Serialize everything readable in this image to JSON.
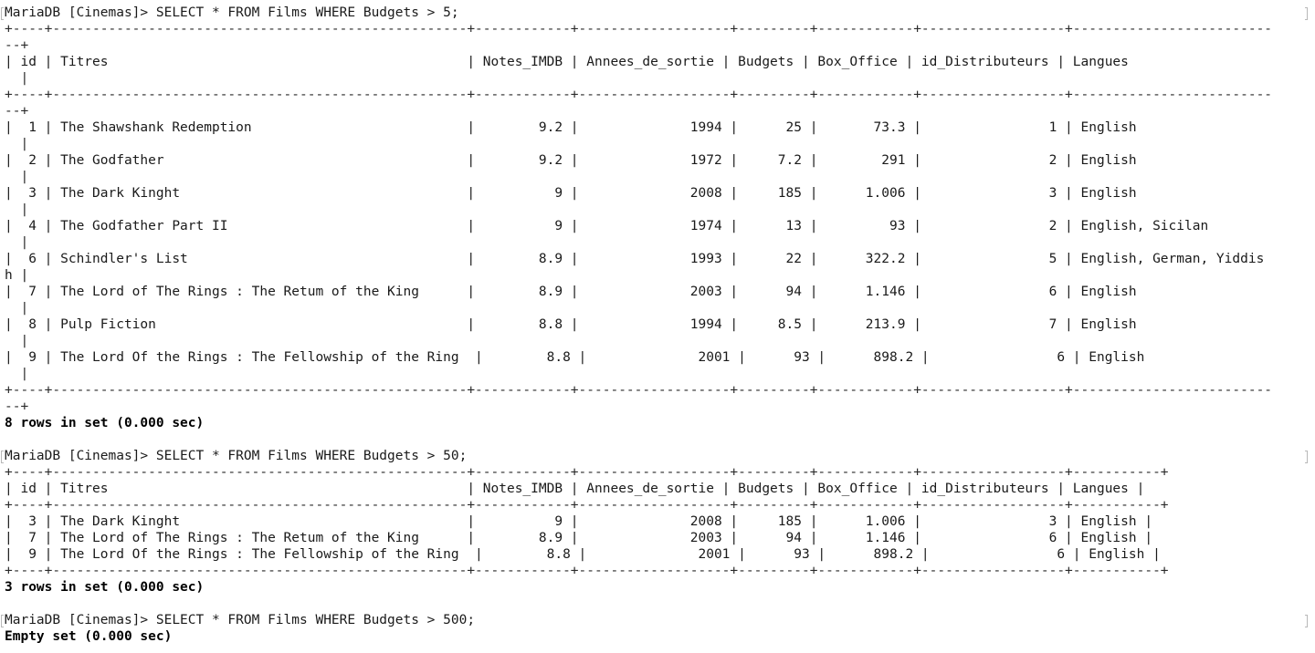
{
  "terminal": {
    "lines": [
      {
        "text": "MariaDB [Cinemas]> SELECT * FROM Films WHERE Budgets > 5;",
        "kind": "prompt"
      },
      {
        "text": "+----+----------------------------------------------------+------------+-------------------+---------+------------+------------------+-------------------------",
        "kind": "border"
      },
      {
        "text": "--+",
        "kind": "border"
      },
      {
        "text": "| id | Titres                                             | Notes_IMDB | Annees_de_sortie | Budgets | Box_Office | id_Distributeurs | Langues",
        "kind": "header"
      },
      {
        "text": "  |",
        "kind": "border"
      },
      {
        "text": "+----+----------------------------------------------------+------------+-------------------+---------+------------+------------------+-------------------------",
        "kind": "border"
      },
      {
        "text": "--+",
        "kind": "border"
      },
      {
        "text": "|  1 | The Shawshank Redemption                           |        9.2 |              1994 |      25 |       73.3 |                1 | English",
        "kind": "row"
      },
      {
        "text": "  |",
        "kind": "border"
      },
      {
        "text": "|  2 | The Godfather                                      |        9.2 |              1972 |     7.2 |        291 |                2 | English",
        "kind": "row"
      },
      {
        "text": "  |",
        "kind": "border"
      },
      {
        "text": "|  3 | The Dark Kinght                                    |          9 |              2008 |     185 |      1.006 |                3 | English",
        "kind": "row"
      },
      {
        "text": "  |",
        "kind": "border"
      },
      {
        "text": "|  4 | The Godfather Part II                              |          9 |              1974 |      13 |         93 |                2 | English, Sicilan",
        "kind": "row"
      },
      {
        "text": "  |",
        "kind": "border"
      },
      {
        "text": "|  6 | Schindler's List                                   |        8.9 |              1993 |      22 |      322.2 |                5 | English, German, Yiddis",
        "kind": "row"
      },
      {
        "text": "h |",
        "kind": "row"
      },
      {
        "text": "|  7 | The Lord of The Rings : The Retum of the King      |        8.9 |              2003 |      94 |      1.146 |                6 | English",
        "kind": "row"
      },
      {
        "text": "  |",
        "kind": "border"
      },
      {
        "text": "|  8 | Pulp Fiction                                       |        8.8 |              1994 |     8.5 |      213.9 |                7 | English",
        "kind": "row"
      },
      {
        "text": "  |",
        "kind": "border"
      },
      {
        "text": "|  9 | The Lord Of the Rings : The Fellowship of the Ring  |        8.8 |              2001 |      93 |      898.2 |                6 | English",
        "kind": "row"
      },
      {
        "text": "  |",
        "kind": "border"
      },
      {
        "text": "+----+----------------------------------------------------+------------+-------------------+---------+------------+------------------+-------------------------",
        "kind": "border"
      },
      {
        "text": "--+",
        "kind": "border"
      },
      {
        "text": "8 rows in set (0.000 sec)",
        "kind": "status"
      },
      {
        "text": "",
        "kind": "blank"
      },
      {
        "text": "MariaDB [Cinemas]> SELECT * FROM Films WHERE Budgets > 50;",
        "kind": "prompt"
      },
      {
        "text": "+----+----------------------------------------------------+------------+-------------------+---------+------------+------------------+-----------+",
        "kind": "border"
      },
      {
        "text": "| id | Titres                                             | Notes_IMDB | Annees_de_sortie | Budgets | Box_Office | id_Distributeurs | Langues |",
        "kind": "header"
      },
      {
        "text": "+----+----------------------------------------------------+------------+-------------------+---------+------------+------------------+-----------+",
        "kind": "border"
      },
      {
        "text": "|  3 | The Dark Kinght                                    |          9 |              2008 |     185 |      1.006 |                3 | English |",
        "kind": "row"
      },
      {
        "text": "|  7 | The Lord of The Rings : The Retum of the King      |        8.9 |              2003 |      94 |      1.146 |                6 | English |",
        "kind": "row"
      },
      {
        "text": "|  9 | The Lord Of the Rings : The Fellowship of the Ring  |        8.8 |              2001 |      93 |      898.2 |                6 | English |",
        "kind": "row"
      },
      {
        "text": "+----+----------------------------------------------------+------------+-------------------+---------+------------+------------------+-----------+",
        "kind": "border"
      },
      {
        "text": "3 rows in set (0.000 sec)",
        "kind": "status"
      },
      {
        "text": "",
        "kind": "blank"
      },
      {
        "text": "MariaDB [Cinemas]> SELECT * FROM Films WHERE Budgets > 500;",
        "kind": "prompt"
      },
      {
        "text": "Empty set (0.000 sec)",
        "kind": "status"
      }
    ]
  }
}
